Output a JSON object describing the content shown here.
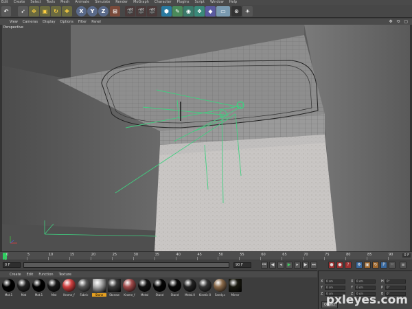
{
  "menu": [
    "Edit",
    "Create",
    "Select",
    "Tools",
    "Mesh",
    "Animate",
    "Simulate",
    "Render",
    "MoGraph",
    "Character",
    "Plugins",
    "Script",
    "Window",
    "Help"
  ],
  "toolbar": {
    "axis_x": "X",
    "axis_y": "Y",
    "axis_z": "Z"
  },
  "viewport": {
    "menu": [
      "View",
      "Cameras",
      "Display",
      "Options",
      "Filter",
      "Panel"
    ],
    "label": "Perspective",
    "nav_icons": "✥ ⟲ ▢"
  },
  "timeline": {
    "ticks": [
      "0",
      "5",
      "10",
      "15",
      "20",
      "25",
      "30",
      "35",
      "40",
      "45",
      "50",
      "55",
      "60",
      "65",
      "70",
      "75",
      "80",
      "85",
      "90"
    ],
    "end_label": "0 F"
  },
  "transport": {
    "start_field": "0 F",
    "current_field": "0 F",
    "end_field": "90 F"
  },
  "materials": {
    "menu": [
      "Create",
      "Edit",
      "Function",
      "Texture"
    ],
    "items": [
      {
        "name": "Mat.1",
        "color": "#000000"
      },
      {
        "name": "Mat",
        "color": "#222222"
      },
      {
        "name": "Mat.1",
        "color": "#000000"
      },
      {
        "name": "Mat",
        "color": "#181818"
      },
      {
        "name": "Krome_f",
        "color": "#d04040"
      },
      {
        "name": "Fabric",
        "color": "#555555"
      },
      {
        "name": "Stone",
        "color": "#b0b0b0"
      },
      {
        "name": "Stonew",
        "color": "#3a3a3a"
      },
      {
        "name": "Krome_f",
        "color": "#a04a4a"
      },
      {
        "name": "Metal",
        "color": "#111111"
      },
      {
        "name": "Stand",
        "color": "#050505"
      },
      {
        "name": "Stand",
        "color": "#080808"
      },
      {
        "name": "Metal.0",
        "color": "#222222"
      },
      {
        "name": "Kinetic 0",
        "color": "#333333"
      },
      {
        "name": "Sandy.s",
        "color": "#8a6a4a"
      },
      {
        "name": "Mirror",
        "color": "#1a1a10"
      }
    ]
  },
  "coords": {
    "rows": [
      {
        "axis": "X",
        "value": "0 cm",
        "axis2": "X",
        "value2": "0 cm",
        "axis3": "H",
        "value3": "0°"
      },
      {
        "axis": "Y",
        "value": "0 cm",
        "axis2": "Y",
        "value2": "0 cm",
        "axis3": "P",
        "value3": "0°"
      },
      {
        "axis": "Z",
        "value": "0 cm",
        "axis2": "Z",
        "value2": "0 cm",
        "axis3": "B",
        "value3": "0°"
      }
    ],
    "object_button": "Object"
  },
  "watermark": "pxleyes.com"
}
